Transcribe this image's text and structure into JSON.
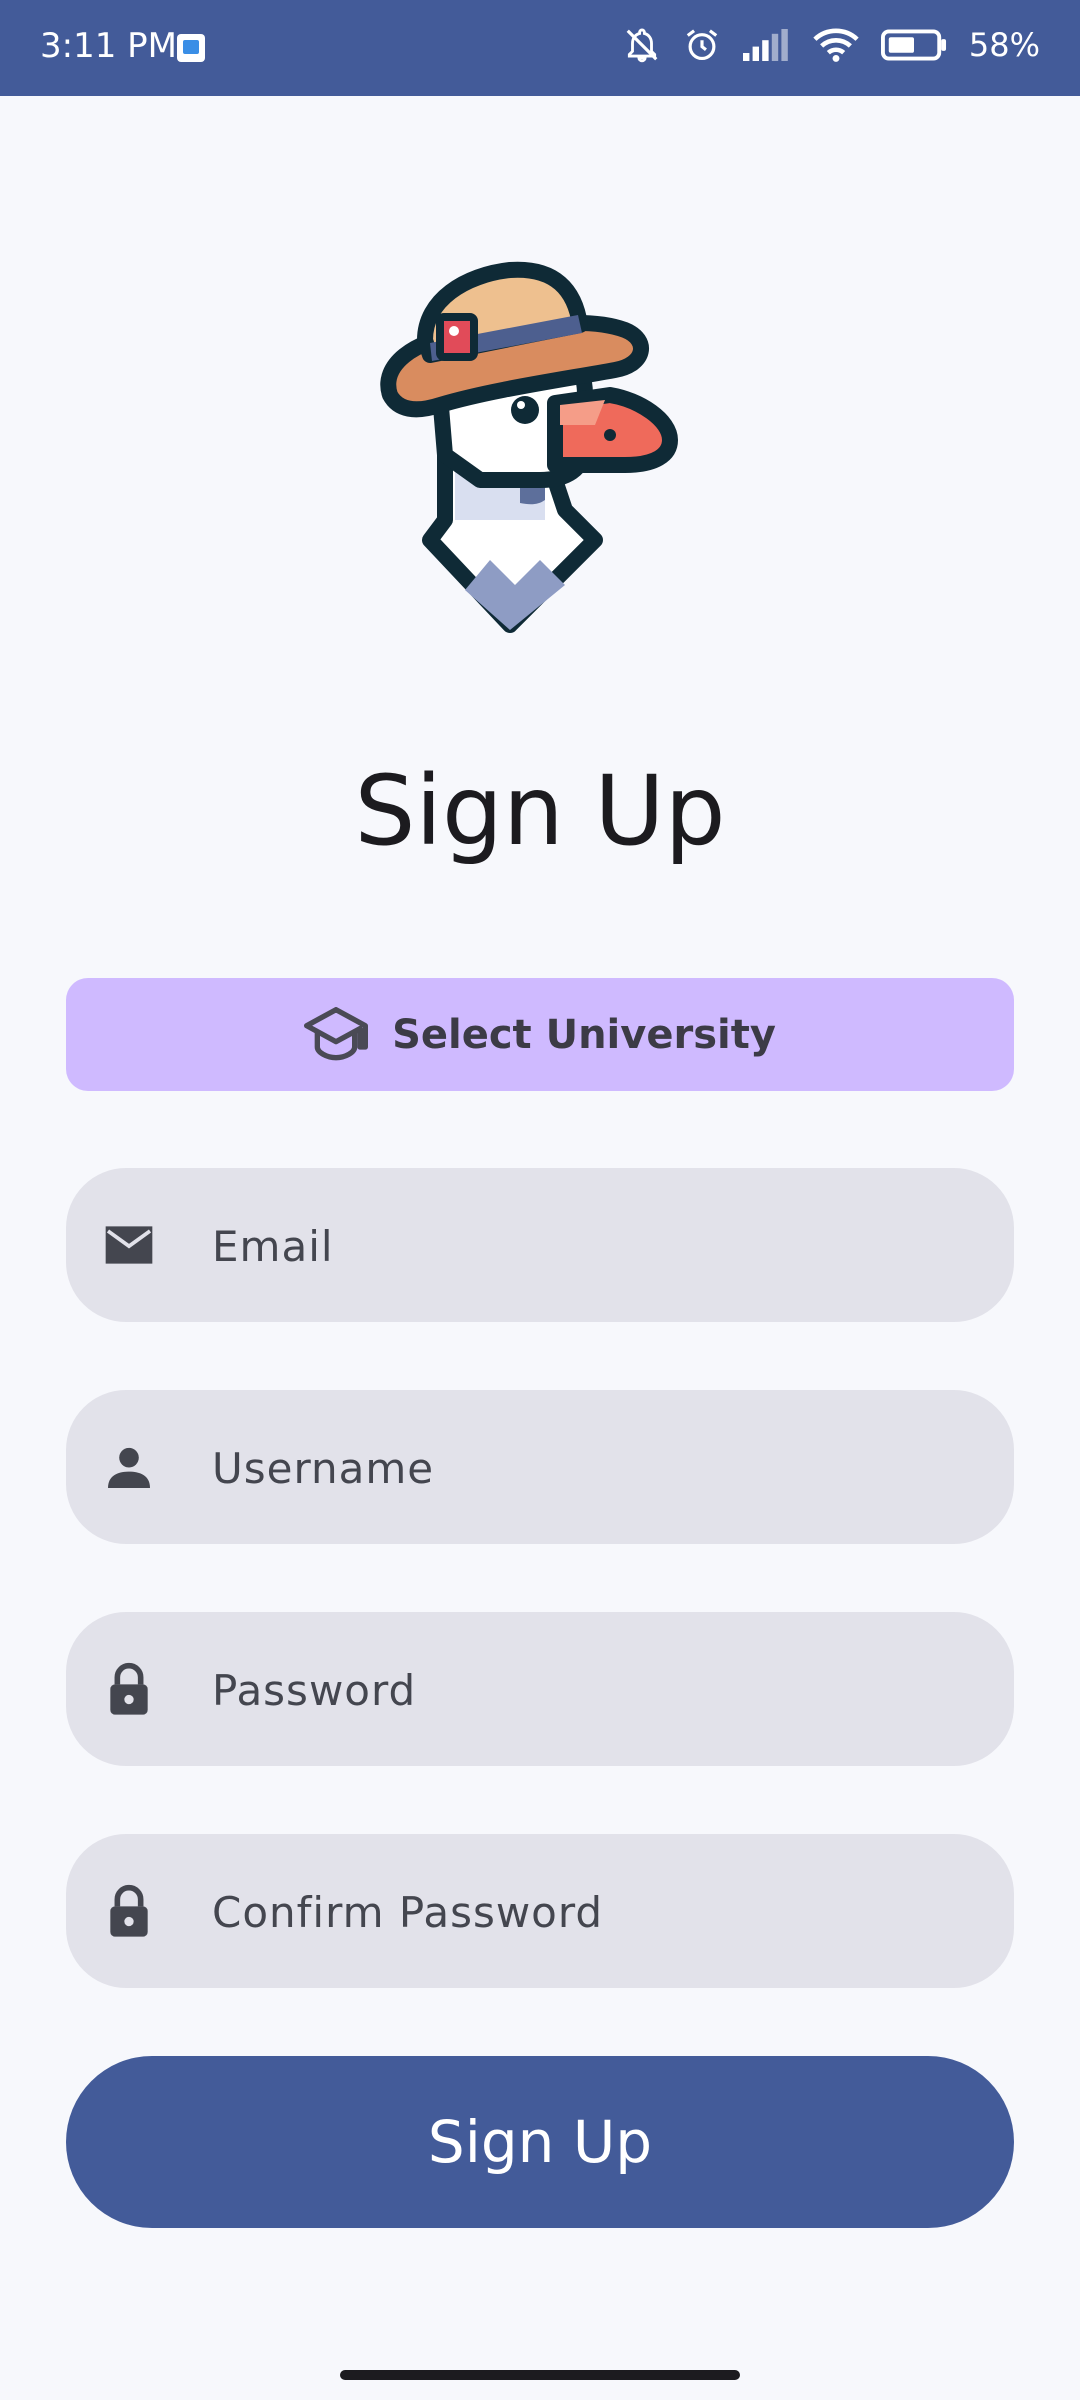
{
  "status_bar": {
    "time": "3:11 PM",
    "battery": "58%",
    "icons": [
      "notification-app-icon",
      "bell-off-icon",
      "alarm-icon",
      "signal-icon",
      "wifi-icon",
      "battery-icon"
    ]
  },
  "logo": {
    "icon": "goose-with-hat-logo"
  },
  "title": "Sign Up",
  "select_university": {
    "label": "Select University",
    "icon": "graduation-cap-icon"
  },
  "fields": {
    "email": {
      "placeholder": "Email",
      "value": "",
      "icon": "envelope-icon"
    },
    "username": {
      "placeholder": "Username",
      "value": "",
      "icon": "person-icon"
    },
    "password": {
      "placeholder": "Password",
      "value": "",
      "icon": "lock-icon"
    },
    "confirm_password": {
      "placeholder": "Confirm Password",
      "value": "",
      "icon": "lock-icon"
    }
  },
  "submit": {
    "label": "Sign Up"
  },
  "colors": {
    "primary": "#435b99",
    "select_button": "#cfbaff",
    "field_background": "#e2e2ea",
    "page_background": "#f7f8fc"
  }
}
